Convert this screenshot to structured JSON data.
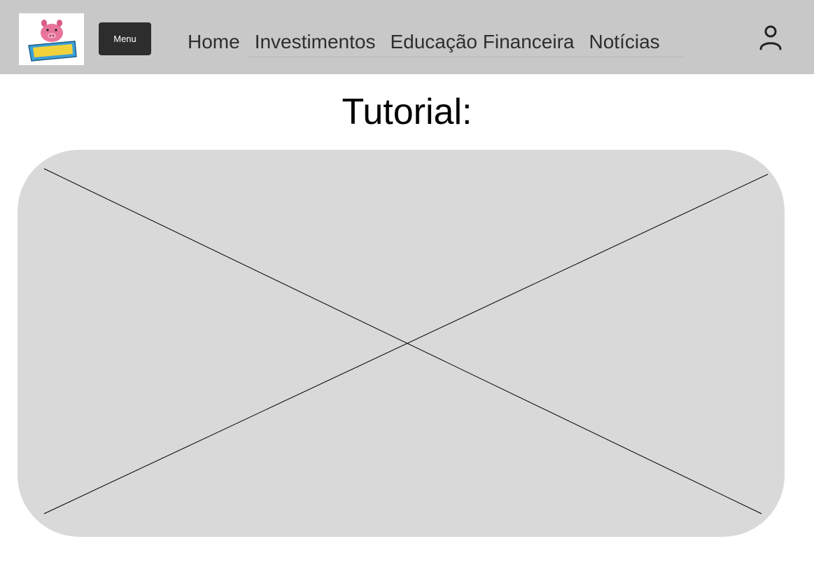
{
  "header": {
    "logo_alt": "TELL ME",
    "menu_label": "Menu",
    "nav": [
      {
        "label": "Home"
      },
      {
        "label": "Investimentos"
      },
      {
        "label": "Educação Financeira"
      },
      {
        "label": "Notícias"
      }
    ],
    "user_icon": "user-icon"
  },
  "main": {
    "title": "Tutorial:",
    "media_placeholder": "image-placeholder"
  },
  "colors": {
    "header_bg": "#c8c8c8",
    "menu_button_bg": "#2d2d2d",
    "placeholder_bg": "#d9d9d9"
  }
}
